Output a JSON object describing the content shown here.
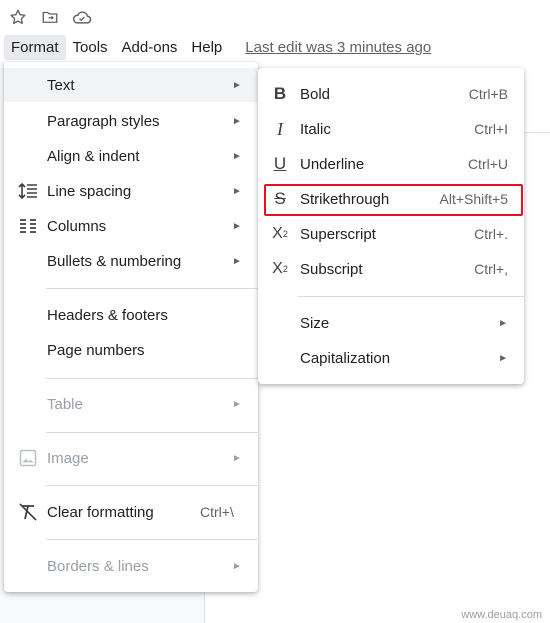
{
  "toolbar_icons": [
    "star-icon",
    "move-to-folder-icon",
    "cloud-saved-icon"
  ],
  "menubar": {
    "items": [
      "Format",
      "Tools",
      "Add-ons",
      "Help"
    ],
    "last_edit": "Last edit was 3 minutes ago"
  },
  "format_menu": {
    "items": [
      {
        "label": "Text",
        "icon": "",
        "arrow": "►"
      },
      {
        "label": "Paragraph styles",
        "icon": "",
        "arrow": "►"
      },
      {
        "label": "Align & indent",
        "icon": "",
        "arrow": "►"
      },
      {
        "label": "Line spacing",
        "icon": "line-spacing-icon",
        "arrow": "►"
      },
      {
        "label": "Columns",
        "icon": "columns-icon",
        "arrow": "►"
      },
      {
        "label": "Bullets & numbering",
        "icon": "",
        "arrow": "►"
      },
      {
        "label": "Headers & footers"
      },
      {
        "label": "Page numbers"
      },
      {
        "label": "Table",
        "arrow": "►",
        "disabled": true
      },
      {
        "label": "Image",
        "icon": "image-icon",
        "arrow": "►",
        "disabled": true
      },
      {
        "label": "Clear formatting",
        "icon": "clear-formatting-icon",
        "shortcut": "Ctrl+\\"
      },
      {
        "label": "Borders & lines",
        "arrow": "►",
        "disabled": true
      }
    ]
  },
  "text_submenu": {
    "items": [
      {
        "label": "Bold",
        "icon": "bold-icon",
        "shortcut": "Ctrl+B"
      },
      {
        "label": "Italic",
        "icon": "italic-icon",
        "shortcut": "Ctrl+I"
      },
      {
        "label": "Underline",
        "icon": "underline-icon",
        "shortcut": "Ctrl+U"
      },
      {
        "label": "Strikethrough",
        "icon": "strikethrough-icon",
        "shortcut": "Alt+Shift+5"
      },
      {
        "label": "Superscript",
        "icon": "superscript-icon",
        "shortcut": "Ctrl+."
      },
      {
        "label": "Subscript",
        "icon": "subscript-icon",
        "shortcut": "Ctrl+,"
      },
      {
        "label": "Size",
        "arrow": "►"
      },
      {
        "label": "Capitalization",
        "arrow": "►"
      }
    ]
  },
  "watermark": "www.deuaq.com",
  "colors": {
    "highlight_border": "#e2141f",
    "hover_bg": "#f1f3f4",
    "disabled_text": "#9aa0a6"
  }
}
